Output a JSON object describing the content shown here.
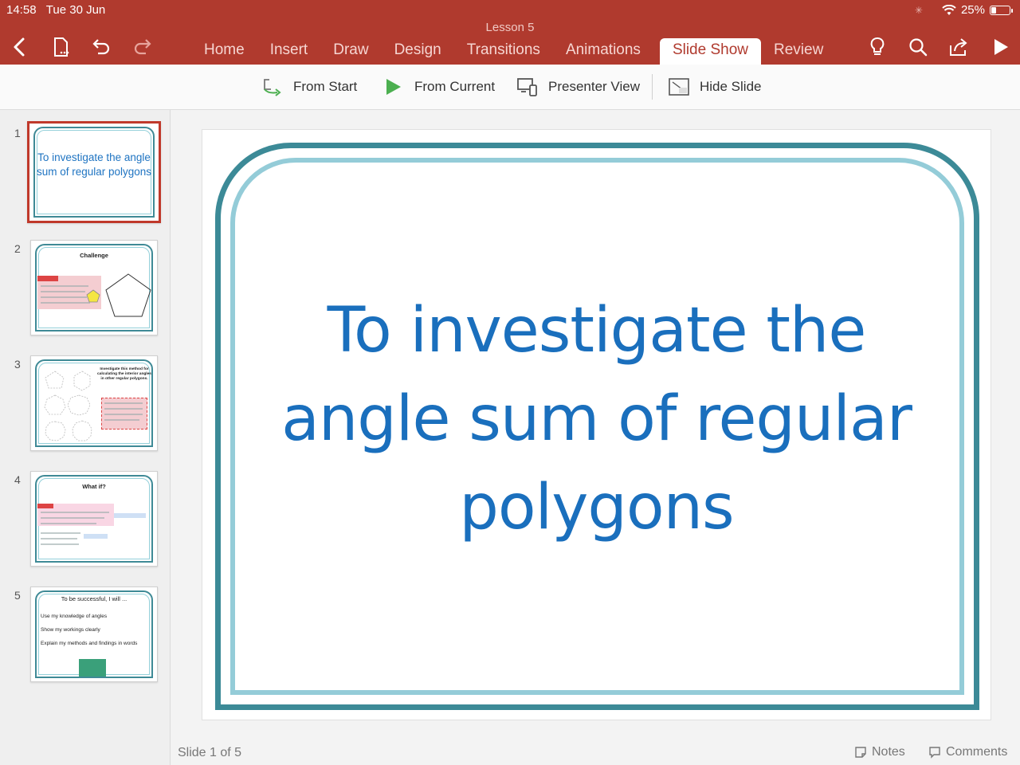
{
  "status": {
    "time": "14:58",
    "date": "Tue 30 Jun",
    "battery": "25%",
    "battery_level": 0.25
  },
  "app": {
    "doc_title": "Lesson 5"
  },
  "toolbar_icons": [
    "back-icon",
    "file-icon",
    "undo-icon",
    "redo-icon",
    "lightbulb-icon",
    "search-icon",
    "share-icon",
    "play-icon"
  ],
  "tabs": [
    {
      "label": "Home"
    },
    {
      "label": "Insert"
    },
    {
      "label": "Draw"
    },
    {
      "label": "Design"
    },
    {
      "label": "Transitions"
    },
    {
      "label": "Animations"
    },
    {
      "label": "Slide Show",
      "active": true
    },
    {
      "label": "Review"
    }
  ],
  "ribbon": {
    "from_start": "From Start",
    "from_current": "From Current",
    "presenter_view": "Presenter View",
    "hide_slide": "Hide Slide"
  },
  "thumbnails": [
    {
      "number": "1",
      "selected": true,
      "title": "To investigate the angle sum of regular polygons"
    },
    {
      "number": "2",
      "title": "Challenge"
    },
    {
      "number": "3",
      "title": "Investigate this method for calculating the interior angles in other regular polygons."
    },
    {
      "number": "4",
      "title": "What if?"
    },
    {
      "number": "5",
      "title": "To be successful, I will ...",
      "lines": [
        "Use my knowledge of angles",
        "Show my workings clearly",
        "Explain my methods and findings in words"
      ]
    }
  ],
  "slide": {
    "title": "To investigate the angle sum of regular polygons"
  },
  "footer": {
    "slide_count": "Slide 1 of 5",
    "notes": "Notes",
    "comments": "Comments"
  },
  "colors": {
    "app_bar": "#b03a2e",
    "title_text": "#1a6fbd",
    "frame_outer": "#3c8a97",
    "frame_inner": "#94ccd8",
    "selection": "#c0392b",
    "play_green": "#4caf50"
  }
}
